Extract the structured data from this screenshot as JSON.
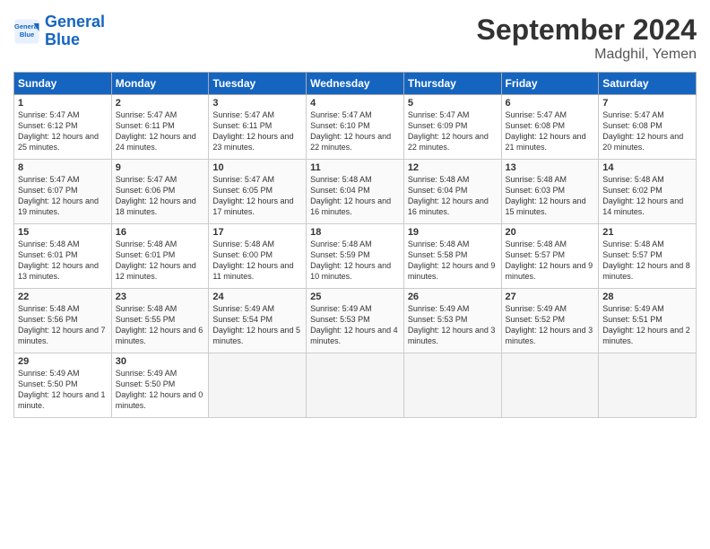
{
  "header": {
    "logo_line1": "General",
    "logo_line2": "Blue",
    "month": "September 2024",
    "location": "Madghil, Yemen"
  },
  "columns": [
    "Sunday",
    "Monday",
    "Tuesday",
    "Wednesday",
    "Thursday",
    "Friday",
    "Saturday"
  ],
  "weeks": [
    [
      {
        "day": "1",
        "info": "Sunrise: 5:47 AM\nSunset: 6:12 PM\nDaylight: 12 hours\nand 25 minutes."
      },
      {
        "day": "2",
        "info": "Sunrise: 5:47 AM\nSunset: 6:11 PM\nDaylight: 12 hours\nand 24 minutes."
      },
      {
        "day": "3",
        "info": "Sunrise: 5:47 AM\nSunset: 6:11 PM\nDaylight: 12 hours\nand 23 minutes."
      },
      {
        "day": "4",
        "info": "Sunrise: 5:47 AM\nSunset: 6:10 PM\nDaylight: 12 hours\nand 22 minutes."
      },
      {
        "day": "5",
        "info": "Sunrise: 5:47 AM\nSunset: 6:09 PM\nDaylight: 12 hours\nand 22 minutes."
      },
      {
        "day": "6",
        "info": "Sunrise: 5:47 AM\nSunset: 6:08 PM\nDaylight: 12 hours\nand 21 minutes."
      },
      {
        "day": "7",
        "info": "Sunrise: 5:47 AM\nSunset: 6:08 PM\nDaylight: 12 hours\nand 20 minutes."
      }
    ],
    [
      {
        "day": "8",
        "info": "Sunrise: 5:47 AM\nSunset: 6:07 PM\nDaylight: 12 hours\nand 19 minutes."
      },
      {
        "day": "9",
        "info": "Sunrise: 5:47 AM\nSunset: 6:06 PM\nDaylight: 12 hours\nand 18 minutes."
      },
      {
        "day": "10",
        "info": "Sunrise: 5:47 AM\nSunset: 6:05 PM\nDaylight: 12 hours\nand 17 minutes."
      },
      {
        "day": "11",
        "info": "Sunrise: 5:48 AM\nSunset: 6:04 PM\nDaylight: 12 hours\nand 16 minutes."
      },
      {
        "day": "12",
        "info": "Sunrise: 5:48 AM\nSunset: 6:04 PM\nDaylight: 12 hours\nand 16 minutes."
      },
      {
        "day": "13",
        "info": "Sunrise: 5:48 AM\nSunset: 6:03 PM\nDaylight: 12 hours\nand 15 minutes."
      },
      {
        "day": "14",
        "info": "Sunrise: 5:48 AM\nSunset: 6:02 PM\nDaylight: 12 hours\nand 14 minutes."
      }
    ],
    [
      {
        "day": "15",
        "info": "Sunrise: 5:48 AM\nSunset: 6:01 PM\nDaylight: 12 hours\nand 13 minutes."
      },
      {
        "day": "16",
        "info": "Sunrise: 5:48 AM\nSunset: 6:01 PM\nDaylight: 12 hours\nand 12 minutes."
      },
      {
        "day": "17",
        "info": "Sunrise: 5:48 AM\nSunset: 6:00 PM\nDaylight: 12 hours\nand 11 minutes."
      },
      {
        "day": "18",
        "info": "Sunrise: 5:48 AM\nSunset: 5:59 PM\nDaylight: 12 hours\nand 10 minutes."
      },
      {
        "day": "19",
        "info": "Sunrise: 5:48 AM\nSunset: 5:58 PM\nDaylight: 12 hours\nand 9 minutes."
      },
      {
        "day": "20",
        "info": "Sunrise: 5:48 AM\nSunset: 5:57 PM\nDaylight: 12 hours\nand 9 minutes."
      },
      {
        "day": "21",
        "info": "Sunrise: 5:48 AM\nSunset: 5:57 PM\nDaylight: 12 hours\nand 8 minutes."
      }
    ],
    [
      {
        "day": "22",
        "info": "Sunrise: 5:48 AM\nSunset: 5:56 PM\nDaylight: 12 hours\nand 7 minutes."
      },
      {
        "day": "23",
        "info": "Sunrise: 5:48 AM\nSunset: 5:55 PM\nDaylight: 12 hours\nand 6 minutes."
      },
      {
        "day": "24",
        "info": "Sunrise: 5:49 AM\nSunset: 5:54 PM\nDaylight: 12 hours\nand 5 minutes."
      },
      {
        "day": "25",
        "info": "Sunrise: 5:49 AM\nSunset: 5:53 PM\nDaylight: 12 hours\nand 4 minutes."
      },
      {
        "day": "26",
        "info": "Sunrise: 5:49 AM\nSunset: 5:53 PM\nDaylight: 12 hours\nand 3 minutes."
      },
      {
        "day": "27",
        "info": "Sunrise: 5:49 AM\nSunset: 5:52 PM\nDaylight: 12 hours\nand 3 minutes."
      },
      {
        "day": "28",
        "info": "Sunrise: 5:49 AM\nSunset: 5:51 PM\nDaylight: 12 hours\nand 2 minutes."
      }
    ],
    [
      {
        "day": "29",
        "info": "Sunrise: 5:49 AM\nSunset: 5:50 PM\nDaylight: 12 hours\nand 1 minute."
      },
      {
        "day": "30",
        "info": "Sunrise: 5:49 AM\nSunset: 5:50 PM\nDaylight: 12 hours\nand 0 minutes."
      },
      null,
      null,
      null,
      null,
      null
    ]
  ]
}
